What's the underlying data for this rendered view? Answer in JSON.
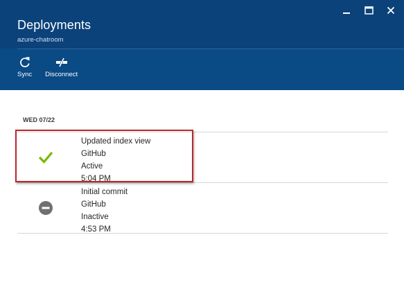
{
  "header": {
    "title": "Deployments",
    "subtitle": "azure-chatroom",
    "background_color": "#0a4a85",
    "window_controls": [
      "minimize-icon",
      "maximize-icon",
      "close-icon"
    ]
  },
  "toolbar": {
    "items": [
      {
        "label": "Sync",
        "icon": "sync-icon"
      },
      {
        "label": "Disconnect",
        "icon": "disconnect-icon"
      }
    ]
  },
  "deployments": {
    "date_label": "WED 07/22",
    "items": [
      {
        "message": "Updated index view",
        "source": "GitHub",
        "status": "Active",
        "time": "5:04 PM",
        "icon": "checkmark-icon",
        "icon_color": "#7ab800"
      },
      {
        "message": "Initial commit",
        "source": "GitHub",
        "status": "Inactive",
        "time": "4:53 PM",
        "icon": "inactive-icon",
        "icon_color": "#707070"
      }
    ]
  },
  "highlight_color": "#b8282c"
}
